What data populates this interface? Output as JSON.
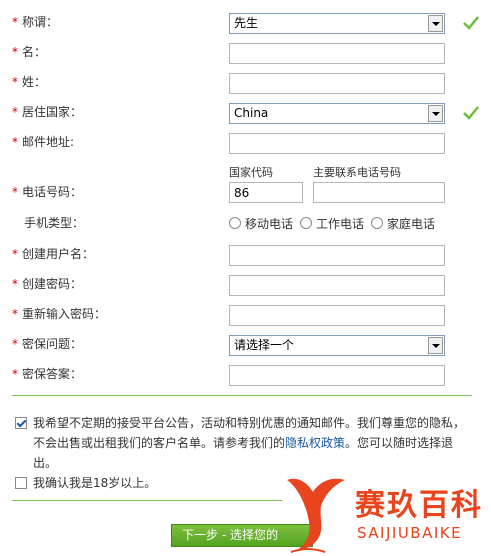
{
  "form": {
    "salutation": {
      "label": "称谓：",
      "value": "先生"
    },
    "first_name": {
      "label": "名：",
      "value": ""
    },
    "last_name": {
      "label": "姓：",
      "value": ""
    },
    "country": {
      "label": "居住国家：",
      "value": "China"
    },
    "email": {
      "label": "邮件地址:",
      "value": ""
    },
    "phone": {
      "label": "电话号码：",
      "country_code_label": "国家代码",
      "country_code_value": "86",
      "number_label": "主要联系电话号码",
      "number_value": ""
    },
    "phone_type": {
      "label": "手机类型：",
      "options": [
        "移动电话",
        "工作电话",
        "家庭电话"
      ]
    },
    "username": {
      "label": "创建用户名：",
      "value": ""
    },
    "password": {
      "label": "创建密码：",
      "value": ""
    },
    "password_confirm": {
      "label": "重新输入密码：",
      "value": ""
    },
    "security_question": {
      "label": "密保问题：",
      "value": "请选择一个"
    },
    "security_answer": {
      "label": "密保答案：",
      "value": ""
    }
  },
  "consent": {
    "text_before": "我希望不定期的接受平台公告，活动和特别优惠的通知邮件。我们尊重您的隐私，不会出售或出租我们的客户名单。请参考我们的",
    "link": "隐私权政策",
    "text_after": "。您可以随时选择退出。",
    "checked": true
  },
  "age": {
    "text": "我确认我是18岁以上。",
    "checked": false
  },
  "next_button": {
    "label": "下一步 - 选择您的"
  },
  "watermark": {
    "cn": "赛玖百科",
    "en": "SAIJIUBAIKE"
  },
  "colors": {
    "required": "#cc0000",
    "check": "#6cbf3a",
    "divider": "#7fc45a",
    "link": "#1a57a6",
    "brand": "#e8441d"
  }
}
